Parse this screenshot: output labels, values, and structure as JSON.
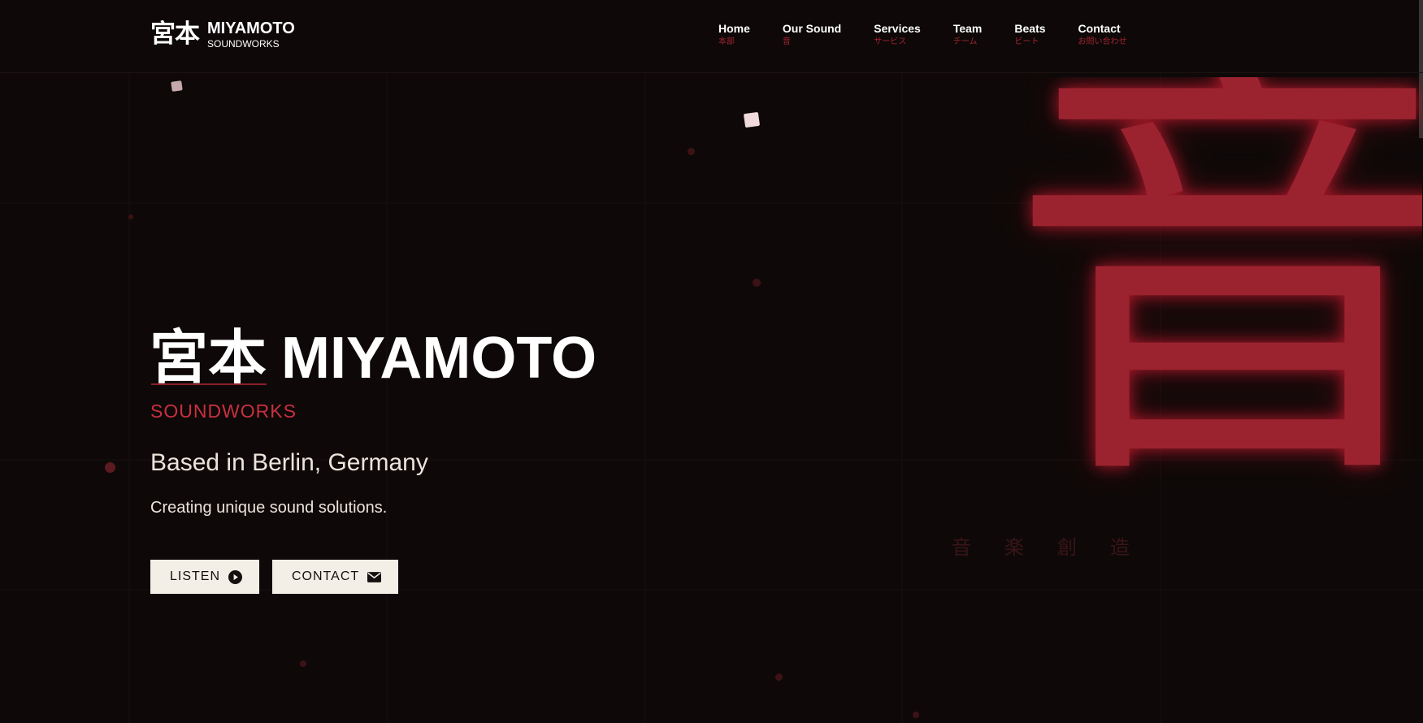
{
  "header": {
    "logo_kanji": "宮本",
    "logo_name": "MIYAMOTO",
    "logo_sub": "SOUNDWORKS"
  },
  "nav": [
    {
      "label": "Home",
      "jp": "本部"
    },
    {
      "label": "Our Sound",
      "jp": "音"
    },
    {
      "label": "Services",
      "jp": "サービス"
    },
    {
      "label": "Team",
      "jp": "チーム"
    },
    {
      "label": "Beats",
      "jp": "ビート"
    },
    {
      "label": "Contact",
      "jp": "お問い合わせ"
    }
  ],
  "hero": {
    "title_jp": "宮本",
    "title_en": "MIYAMOTO",
    "subtitle": "SOUNDWORKS",
    "location": "Based in Berlin, Germany",
    "description": "Creating unique sound solutions.",
    "listen_label": "LISTEN",
    "contact_label": "CONTACT"
  },
  "decor": {
    "big_glyph": "音",
    "kanji_row": [
      "音",
      "楽",
      "創",
      "造"
    ]
  },
  "icons": {
    "listen": "play-circle-icon",
    "contact": "envelope-icon"
  },
  "colors": {
    "background": "#0e0908",
    "accent": "#c8303f",
    "glyph": "#9b232f",
    "button_bg": "#f4efe6"
  }
}
